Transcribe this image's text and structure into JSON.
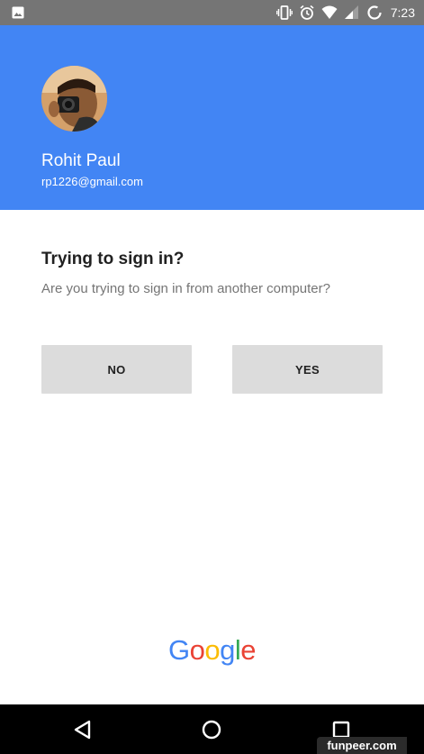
{
  "status_bar": {
    "time": "7:23",
    "icons": [
      "image-notification-icon",
      "vibrate-icon",
      "alarm-icon",
      "wifi-icon",
      "cell-signal-icon",
      "sync-icon"
    ]
  },
  "account": {
    "name": "Rohit Paul",
    "email": "rp1226@gmail.com"
  },
  "prompt": {
    "title": "Trying to sign in?",
    "text": "Are you trying to sign in from another computer?"
  },
  "buttons": {
    "no_label": "NO",
    "yes_label": "YES"
  },
  "logo": {
    "text": "Google",
    "letters": [
      "G",
      "o",
      "o",
      "g",
      "l",
      "e"
    ],
    "colors": [
      "#4285F4",
      "#EA4335",
      "#FBBC05",
      "#4285F4",
      "#34A853",
      "#EA4335"
    ]
  },
  "nav_bar": {
    "buttons": [
      "back-icon",
      "home-icon",
      "recents-icon"
    ]
  },
  "watermark": "funpeer.com",
  "colors": {
    "header_bg": "#4285f4",
    "status_bar_bg": "#757575",
    "button_bg": "#dcdcdc",
    "nav_bar_bg": "#000000"
  }
}
